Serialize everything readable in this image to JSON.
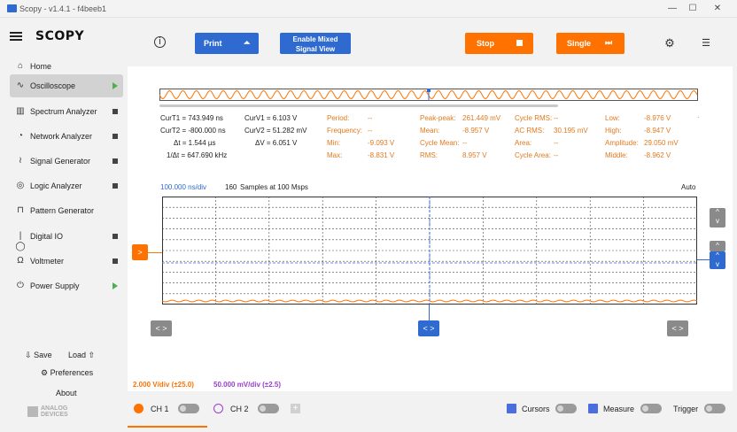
{
  "window": {
    "title": "Scopy - v1.4.1 - f4beeb1",
    "minimize": "—",
    "maximize": "☐",
    "close": "✕"
  },
  "app": {
    "logo": "SCOPY"
  },
  "sidebar": {
    "items": [
      {
        "label": "Home",
        "icon": "home-icon",
        "glyph": "⌂",
        "status": "none"
      },
      {
        "label": "Oscilloscope",
        "icon": "oscilloscope-icon",
        "glyph": "∿",
        "status": "running",
        "active": true
      },
      {
        "label": "Spectrum Analyzer",
        "icon": "spectrum-icon",
        "glyph": "▥",
        "status": "stopped"
      },
      {
        "label": "Network Analyzer",
        "icon": "network-icon",
        "glyph": "◔",
        "status": "stopped"
      },
      {
        "label": "Signal Generator",
        "icon": "signal-generator-icon",
        "glyph": "≀",
        "status": "stopped"
      },
      {
        "label": "Logic Analyzer",
        "icon": "logic-analyzer-icon",
        "glyph": "◎",
        "status": "stopped"
      },
      {
        "label": "Pattern Generator",
        "icon": "pattern-generator-icon",
        "glyph": "⊓",
        "status": "none"
      },
      {
        "label": "Digital IO",
        "icon": "digital-io-icon",
        "glyph": "|◯",
        "status": "stopped"
      },
      {
        "label": "Voltmeter",
        "icon": "voltmeter-icon",
        "glyph": "Ω",
        "status": "stopped"
      },
      {
        "label": "Power Supply",
        "icon": "power-supply-icon",
        "glyph": "⏻",
        "status": "running"
      }
    ],
    "save": "Save",
    "load": "Load",
    "preferences": "Preferences",
    "about": "About",
    "vendor_line1": "ANALOG",
    "vendor_line2": "DEVICES"
  },
  "toolbar": {
    "print": "Print",
    "mixed_signal_line1": "Enable Mixed",
    "mixed_signal_line2": "Signal View",
    "stop": "Stop",
    "single": "Single"
  },
  "cursors": {
    "curT1": "CurT1 = 743.949 ns",
    "curT2": "CurT2 = -800.000 ns",
    "deltaT": "Δt = 1.544 µs",
    "invDeltaT": "1/Δt = 647.690 kHz",
    "curV1": "CurV1 = 6.103 V",
    "curV2": "CurV2 = 51.282 mV",
    "deltaV": "ΔV = 6.051 V"
  },
  "measurements": [
    {
      "label": "Period:",
      "value": "--"
    },
    {
      "label": "Frequency:",
      "value": "--"
    },
    {
      "label": "Min:",
      "value": "-9.093 V"
    },
    {
      "label": "Max:",
      "value": "-8.831 V"
    },
    {
      "label": "Peak-peak:",
      "value": "261.449 mV"
    },
    {
      "label": "Mean:",
      "value": "-8.957 V"
    },
    {
      "label": "Cycle Mean:",
      "value": "--"
    },
    {
      "label": "RMS:",
      "value": "8.957 V"
    },
    {
      "label": "Cycle RMS:",
      "value": "--"
    },
    {
      "label": "AC RMS:",
      "value": "30.195 mV"
    },
    {
      "label": "Area:",
      "value": "--"
    },
    {
      "label": "Cycle Area:",
      "value": "--"
    },
    {
      "label": "Low:",
      "value": "-8.976 V"
    },
    {
      "label": "High:",
      "value": "-8.947 V"
    },
    {
      "label": "Amplitude:",
      "value": "29.050 mV"
    },
    {
      "label": "Middle:",
      "value": "-8.962 V"
    }
  ],
  "plot": {
    "timebase": "100.000 ns/div",
    "samples_count": "160",
    "samples_rate": "Samples at 100 Msps",
    "trigger_mode": "Auto",
    "arrow_left_right": "< >",
    "arrow_right": ">",
    "arrow_up": "^",
    "arrow_down": "v"
  },
  "scale": {
    "ch1": "2.000 V/div (±25.0)",
    "ch2": "50.000 mV/div (±2.5)"
  },
  "bottom": {
    "ch1": "CH 1",
    "ch2": "CH 2",
    "add": "+",
    "cursors": "Cursors",
    "measure": "Measure",
    "trigger": "Trigger"
  },
  "colors": {
    "ch1": "#ff7200",
    "ch2": "#9b3dce",
    "accent_blue": "#2f6ad0",
    "measure_text": "#e07a20"
  }
}
